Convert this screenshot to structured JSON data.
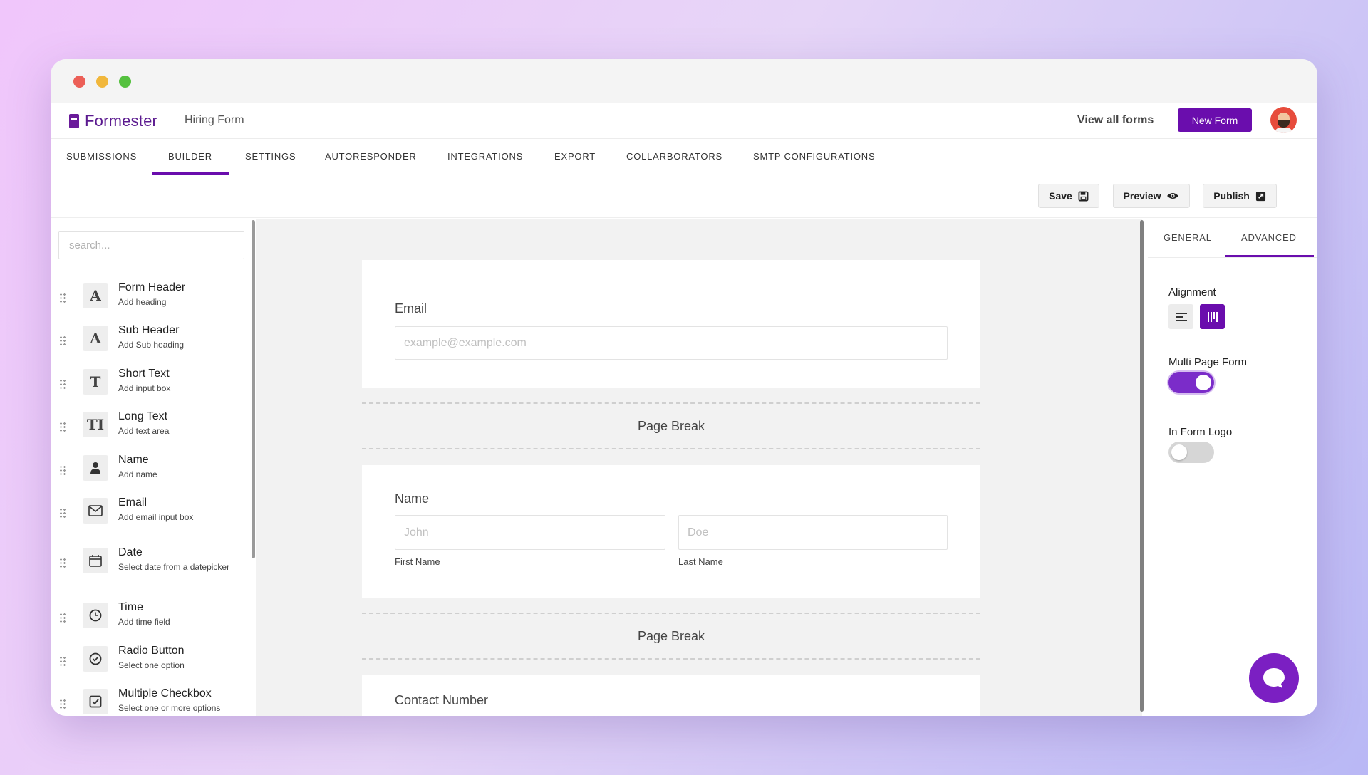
{
  "window": {
    "controls": [
      "close",
      "minimize",
      "maximize"
    ]
  },
  "app": {
    "brand": "Formester",
    "form_name": "Hiring Form",
    "view_all": "View all forms",
    "new_form": "New Form",
    "accent": "#6a0dad"
  },
  "tabs": [
    "SUBMISSIONS",
    "BUILDER",
    "SETTINGS",
    "AUTORESPONDER",
    "INTEGRATIONS",
    "EXPORT",
    "COLLARBORATORS",
    "SMTP CONFIGURATIONS"
  ],
  "active_tab": "BUILDER",
  "actions": {
    "save": "Save",
    "preview": "Preview",
    "publish": "Publish"
  },
  "sidebar": {
    "search_placeholder": "search...",
    "components": [
      {
        "title": "Form Header",
        "sub": "Add heading",
        "icon": "A"
      },
      {
        "title": "Sub Header",
        "sub": "Add Sub heading",
        "icon": "A"
      },
      {
        "title": "Short Text",
        "sub": "Add input box",
        "icon": "T"
      },
      {
        "title": "Long Text",
        "sub": "Add text area",
        "icon": "TI"
      },
      {
        "title": "Name",
        "sub": "Add name",
        "icon": "person-icon"
      },
      {
        "title": "Email",
        "sub": "Add email input box",
        "icon": "envelope-icon"
      },
      {
        "title": "Date",
        "sub": "Select date from a datepicker",
        "icon": "calendar-icon"
      },
      {
        "title": "Time",
        "sub": "Add time field",
        "icon": "clock-icon"
      },
      {
        "title": "Radio Button",
        "sub": "Select one option",
        "icon": "radio-check-icon"
      },
      {
        "title": "Multiple Checkbox",
        "sub": "Select one or more options",
        "icon": "checkbox-icon"
      }
    ]
  },
  "canvas": {
    "email": {
      "label": "Email",
      "placeholder": "example@example.com"
    },
    "page_break": "Page Break",
    "name": {
      "label": "Name",
      "first_placeholder": "John",
      "last_placeholder": "Doe",
      "first_label": "First Name",
      "last_label": "Last Name"
    },
    "contact": {
      "label": "Contact Number"
    }
  },
  "right_panel": {
    "tabs": [
      "GENERAL",
      "ADVANCED"
    ],
    "active_tab": "ADVANCED",
    "alignment_label": "Alignment",
    "multi_page_label": "Multi Page Form",
    "multi_page_on": true,
    "logo_label": "In Form Logo",
    "logo_on": false
  }
}
